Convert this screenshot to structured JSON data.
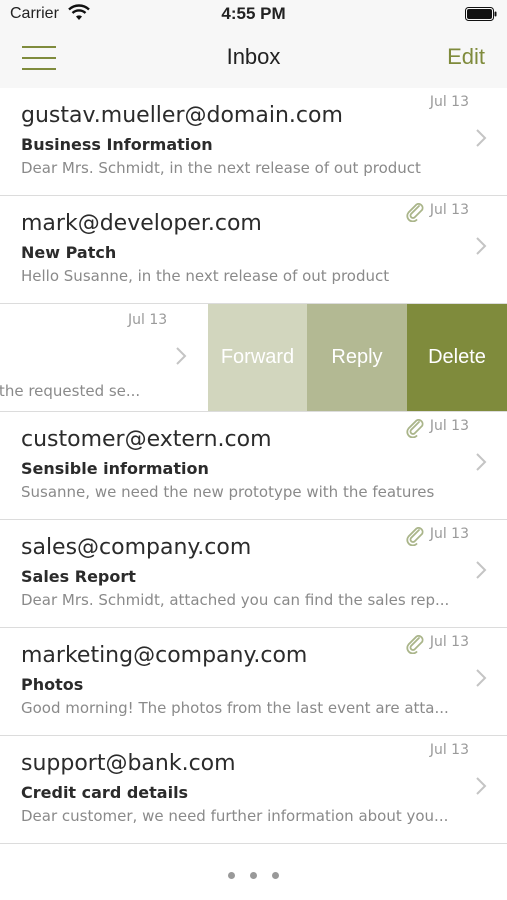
{
  "status_bar": {
    "carrier": "Carrier",
    "time": "4:55 PM"
  },
  "nav": {
    "title": "Inbox",
    "edit_label": "Edit"
  },
  "emails": [
    {
      "from": "gustav.mueller@domain.com",
      "subject": "Business Information",
      "preview": "Dear Mrs. Schmidt, in the next release of out product",
      "date": "Jul 13",
      "attachment": false
    },
    {
      "from": "mark@developer.com",
      "subject": "New Patch",
      "preview": "Hello Susanne, in the next release of out product",
      "date": "Jul 13",
      "attachment": true
    },
    {
      "preview": "r the requested se...",
      "date": "Jul 13",
      "swiped": true
    },
    {
      "from": "customer@extern.com",
      "subject": "Sensible information",
      "preview": "Susanne, we need the new prototype with the features",
      "date": "Jul 13",
      "attachment": true
    },
    {
      "from": "sales@company.com",
      "subject": "Sales Report",
      "preview": "Dear Mrs. Schmidt, attached you can find the sales rep...",
      "date": "Jul 13",
      "attachment": true
    },
    {
      "from": "marketing@company.com",
      "subject": "Photos",
      "preview": "Good morning! The photos from the last event are atta...",
      "date": "Jul 13",
      "attachment": true
    },
    {
      "from": "support@bank.com",
      "subject": "Credit card details",
      "preview": "Dear customer, we need further information about you...",
      "date": "Jul 13",
      "attachment": false
    }
  ],
  "swipe_actions": {
    "forward": "Forward",
    "reply": "Reply",
    "delete": "Delete"
  },
  "colors": {
    "accent": "#7f8b3c",
    "forward_bg": "#d2d6be",
    "reply_bg": "#b3b993",
    "delete_bg": "#7f8b3c"
  }
}
